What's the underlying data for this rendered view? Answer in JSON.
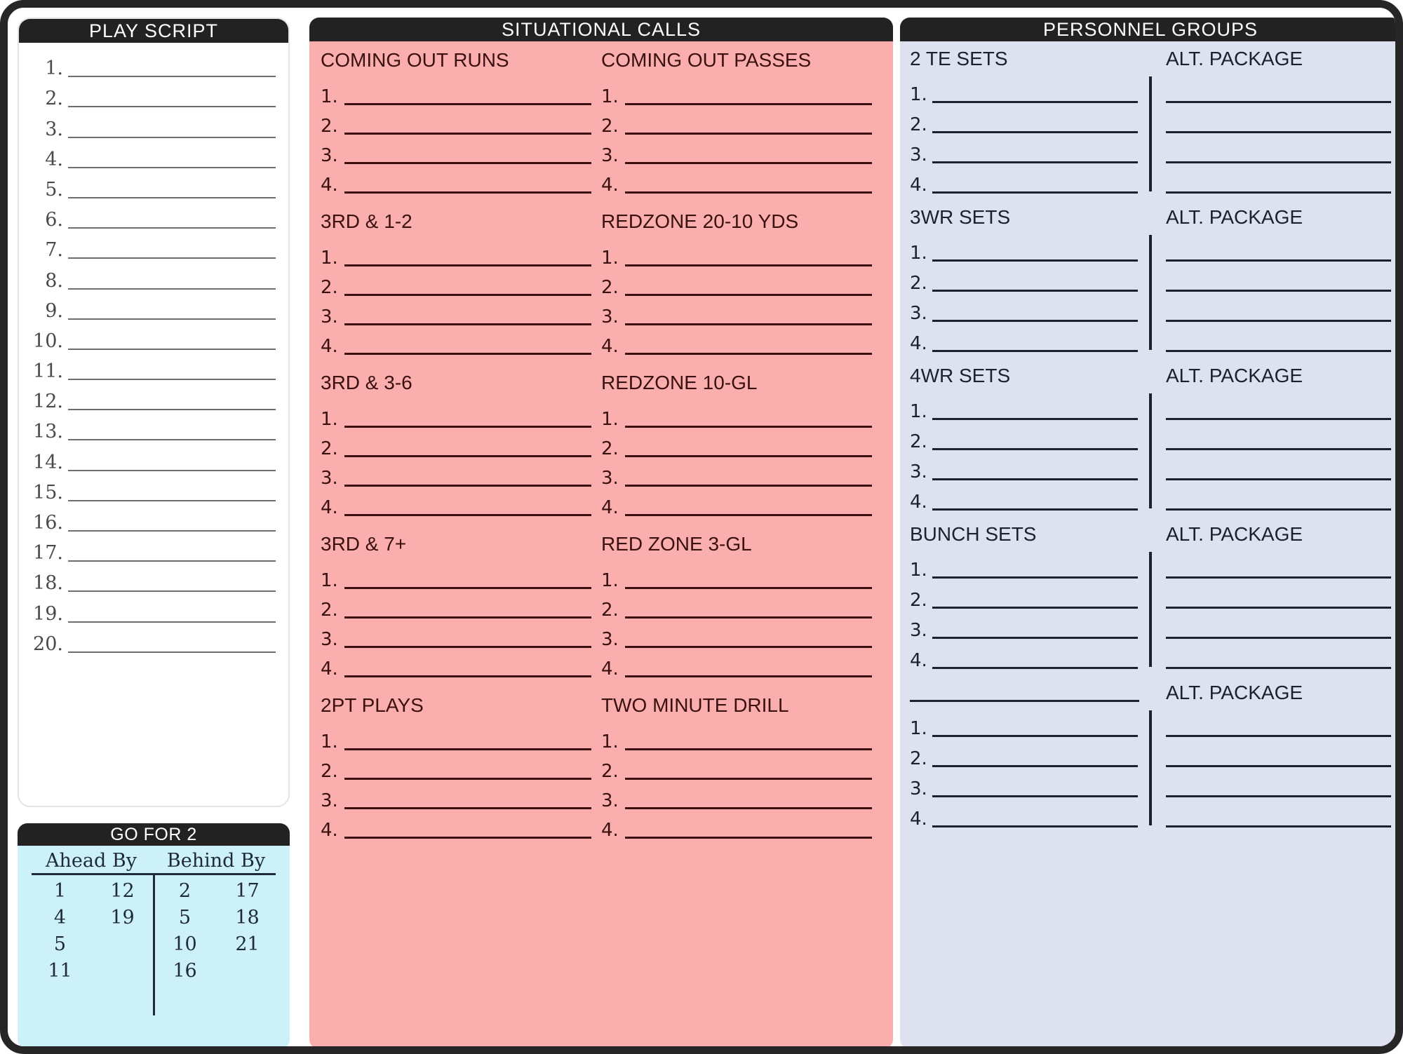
{
  "colors": {
    "frame": "#262626",
    "header_bg": "#222222",
    "header_text": "#ffffff",
    "play_script_bg": "#ffffff",
    "go_for_2_bg": "#cdf1f9",
    "situational_bg": "#fbaeae",
    "situational_ink": "#3a1010",
    "personnel_bg": "#dde1f0",
    "personnel_ink": "#1b2132"
  },
  "play_script": {
    "title": "PLAY SCRIPT",
    "numbers": [
      "1.",
      "2.",
      "3.",
      "4.",
      "5.",
      "6.",
      "7.",
      "8.",
      "9.",
      "10.",
      "11.",
      "12.",
      "13.",
      "14.",
      "15.",
      "16.",
      "17.",
      "18.",
      "19.",
      "20."
    ]
  },
  "go_for_2": {
    "title": "GO FOR 2",
    "headers": [
      "Ahead By",
      "Behind By"
    ],
    "ahead_by": {
      "col1": [
        "1",
        "4",
        "5",
        "11"
      ],
      "col2": [
        "12",
        "19",
        "",
        ""
      ]
    },
    "behind_by": {
      "col1": [
        "2",
        "5",
        "10",
        "16"
      ],
      "col2": [
        "17",
        "18",
        "21",
        ""
      ]
    }
  },
  "situational_calls": {
    "title": "SITUATIONAL CALLS",
    "row_numbers": [
      "1.",
      "2.",
      "3.",
      "4."
    ],
    "left_column": [
      {
        "label": "COMING OUT RUNS"
      },
      {
        "label": "3RD & 1-2"
      },
      {
        "label": "3RD & 3-6"
      },
      {
        "label": "3RD & 7+"
      },
      {
        "label": "2PT PLAYS"
      }
    ],
    "right_column": [
      {
        "label": "COMING OUT PASSES"
      },
      {
        "label": "REDZONE 20-10 YDS"
      },
      {
        "label": "REDZONE 10-GL"
      },
      {
        "label": "RED ZONE 3-GL"
      },
      {
        "label": "TWO MINUTE DRILL"
      }
    ]
  },
  "personnel_groups": {
    "title": "PERSONNEL GROUPS",
    "row_numbers": [
      "1.",
      "2.",
      "3.",
      "4."
    ],
    "alt_package_label": "ALT. PACKAGE",
    "blocks": [
      {
        "label": "2 TE SETS",
        "label_is_blank_line": false
      },
      {
        "label": "3WR SETS",
        "label_is_blank_line": false
      },
      {
        "label": "4WR SETS",
        "label_is_blank_line": false
      },
      {
        "label": "BUNCH SETS",
        "label_is_blank_line": false
      },
      {
        "label": "",
        "label_is_blank_line": true
      }
    ]
  }
}
